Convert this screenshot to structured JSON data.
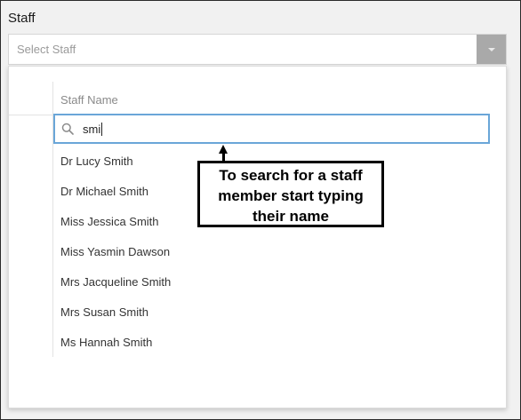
{
  "field": {
    "label": "Staff",
    "placeholder": "Select Staff"
  },
  "dropdown": {
    "column_header": "Staff Name",
    "search_value": "smi",
    "items": [
      {
        "label": "Dr Lucy Smith"
      },
      {
        "label": "Dr Michael Smith"
      },
      {
        "label": "Miss Jessica Smith"
      },
      {
        "label": "Miss Yasmin Dawson"
      },
      {
        "label": "Mrs Jacqueline Smith"
      },
      {
        "label": "Mrs Susan Smith"
      },
      {
        "label": "Ms Hannah Smith"
      }
    ]
  },
  "callout": {
    "lines": [
      "To search for a staff",
      "member start typing",
      "their name"
    ]
  },
  "icons": {
    "search": "search-icon",
    "dropdown": "chevron-down-icon"
  },
  "colors": {
    "search_border": "#6aa6d8",
    "dropdown_button": "#a9a9a9"
  }
}
